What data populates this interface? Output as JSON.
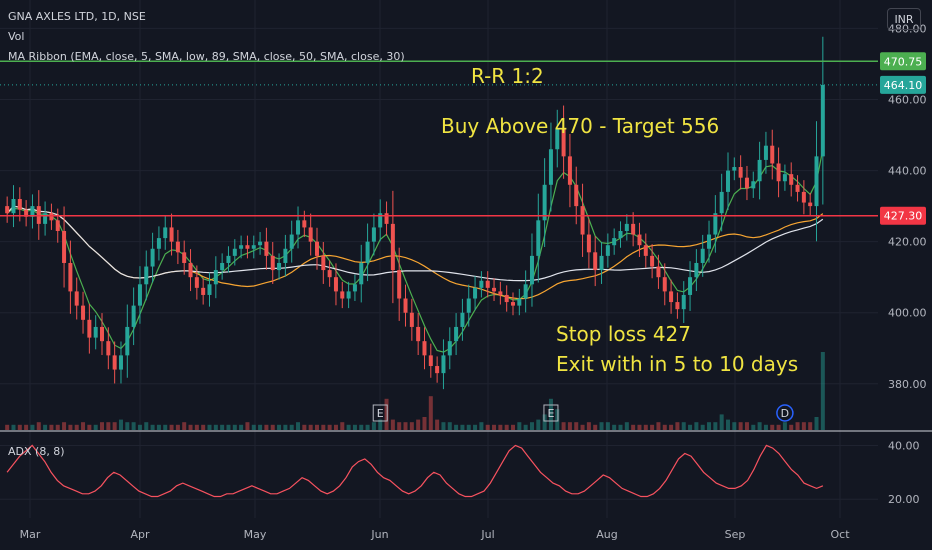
{
  "header": {
    "symbol_line": "GNA AXLES LTD, 1D, NSE",
    "vol_label": "Vol",
    "ma_label": "MA Ribbon (EMA, close, 5, SMA, low, 89, SMA, close, 50, SMA, close, 30)",
    "currency": "INR"
  },
  "annotations": {
    "rr": "R-R 1:2",
    "buy": "Buy Above 470 - Target 556",
    "stop": "Stop loss 427",
    "exit": "Exit with in 5 to 10 days"
  },
  "indicator": {
    "label": "ADX (8, 8)"
  },
  "colors": {
    "background": "#131722",
    "up": "#26a69a",
    "down": "#ef5350",
    "green_line": "#4caf50",
    "red_line": "#f23645",
    "ma_fast": "#4caf50",
    "ma_mid": "#f7a532",
    "ma_slow": "#e0e3eb",
    "adx": "#f7525f",
    "annotation": "#f0e442"
  },
  "chart_data": {
    "type": "candlestick",
    "symbol": "GNA AXLES LTD",
    "timeframe": "1D",
    "exchange": "NSE",
    "x_labels": [
      "Mar",
      "Apr",
      "May",
      "Jun",
      "Jul",
      "Aug",
      "Sep",
      "Oct"
    ],
    "price_axis": {
      "ticks": [
        380,
        400,
        420,
        440,
        460,
        480
      ],
      "tick_labels": [
        "380.00",
        "400.00",
        "420.00",
        "440.00",
        "460.00",
        "480.00"
      ],
      "ylim": [
        367,
        488
      ]
    },
    "horizontal_lines": [
      {
        "value": 470.75,
        "label": "470.75",
        "color": "#4caf50"
      },
      {
        "value": 427.3,
        "label": "427.30",
        "color": "#f23645"
      }
    ],
    "last_price": {
      "value": 464.1,
      "label": "464.10"
    },
    "series": {
      "close": [
        428,
        432,
        429,
        427,
        430,
        425,
        428,
        426,
        423,
        414,
        406,
        402,
        398,
        393,
        396,
        392,
        388,
        384,
        388,
        396,
        402,
        408,
        413,
        418,
        421,
        424,
        420,
        417,
        414,
        410,
        407,
        405,
        408,
        412,
        414,
        416,
        418,
        419,
        418,
        419,
        420,
        416,
        412,
        414,
        418,
        422,
        426,
        424,
        420,
        416,
        412,
        410,
        406,
        404,
        406,
        408,
        414,
        420,
        424,
        428,
        425,
        412,
        404,
        400,
        396,
        392,
        388,
        385,
        383,
        388,
        392,
        396,
        400,
        404,
        407,
        409,
        407,
        406,
        405,
        403,
        402,
        404,
        408,
        416,
        426,
        436,
        446,
        452,
        444,
        436,
        430,
        422,
        417,
        412,
        416,
        419,
        421,
        423,
        425,
        422,
        419,
        416,
        413,
        410,
        406,
        403,
        401,
        405,
        410,
        414,
        418,
        422,
        428,
        434,
        440,
        441,
        438,
        435,
        437,
        443,
        447,
        442,
        437,
        439,
        436,
        434,
        431,
        430,
        444,
        464.1
      ],
      "volume": [
        2,
        2,
        2,
        2,
        2,
        3,
        2,
        2,
        2,
        3,
        2,
        2,
        3,
        2,
        2,
        3,
        3,
        3,
        4,
        3,
        3,
        2,
        3,
        2,
        2,
        2,
        2,
        2,
        3,
        2,
        2,
        2,
        2,
        2,
        2,
        2,
        2,
        2,
        3,
        2,
        2,
        2,
        2,
        2,
        2,
        2,
        3,
        2,
        2,
        2,
        2,
        2,
        2,
        3,
        2,
        2,
        2,
        2,
        3,
        4,
        12,
        4,
        3,
        3,
        3,
        4,
        5,
        13,
        4,
        3,
        3,
        2,
        2,
        2,
        2,
        3,
        2,
        2,
        2,
        2,
        2,
        3,
        2,
        3,
        4,
        6,
        12,
        8,
        3,
        3,
        3,
        2,
        3,
        2,
        3,
        3,
        2,
        2,
        3,
        2,
        2,
        2,
        2,
        3,
        2,
        2,
        3,
        3,
        2,
        3,
        2,
        3,
        3,
        6,
        4,
        3,
        3,
        3,
        2,
        3,
        2,
        2,
        2,
        3,
        2,
        3,
        3,
        3,
        5,
        30
      ],
      "adx": [
        30,
        33,
        36,
        38,
        40,
        37,
        34,
        30,
        27,
        25,
        24,
        23,
        22,
        22,
        23,
        25,
        28,
        30,
        29,
        27,
        25,
        23,
        22,
        21,
        21,
        22,
        23,
        25,
        26,
        25,
        24,
        23,
        22,
        21,
        21,
        22,
        22,
        23,
        24,
        25,
        24,
        23,
        22,
        22,
        23,
        24,
        26,
        28,
        27,
        25,
        23,
        22,
        23,
        25,
        28,
        32,
        34,
        35,
        33,
        30,
        28,
        27,
        25,
        23,
        22,
        23,
        25,
        28,
        30,
        29,
        26,
        24,
        22,
        21,
        21,
        22,
        23,
        26,
        30,
        34,
        38,
        40,
        39,
        36,
        33,
        30,
        28,
        26,
        25,
        23,
        22,
        22,
        23,
        25,
        27,
        29,
        28,
        26,
        24,
        23,
        22,
        21,
        21,
        22,
        24,
        27,
        31,
        35,
        37,
        36,
        33,
        30,
        28,
        26,
        25,
        24,
        24,
        25,
        27,
        31,
        36,
        40,
        39,
        37,
        34,
        31,
        29,
        26,
        25,
        24,
        25
      ]
    },
    "adx_axis": {
      "ticks": [
        20,
        40
      ],
      "tick_labels": [
        "20.00",
        "40.00"
      ],
      "ylim": [
        13,
        45
      ]
    },
    "event_markers": [
      {
        "label": "E",
        "index": 59
      },
      {
        "label": "E",
        "index": 86
      },
      {
        "label": "D",
        "index": 123
      }
    ],
    "grid": true,
    "legend_position": "top-left"
  }
}
